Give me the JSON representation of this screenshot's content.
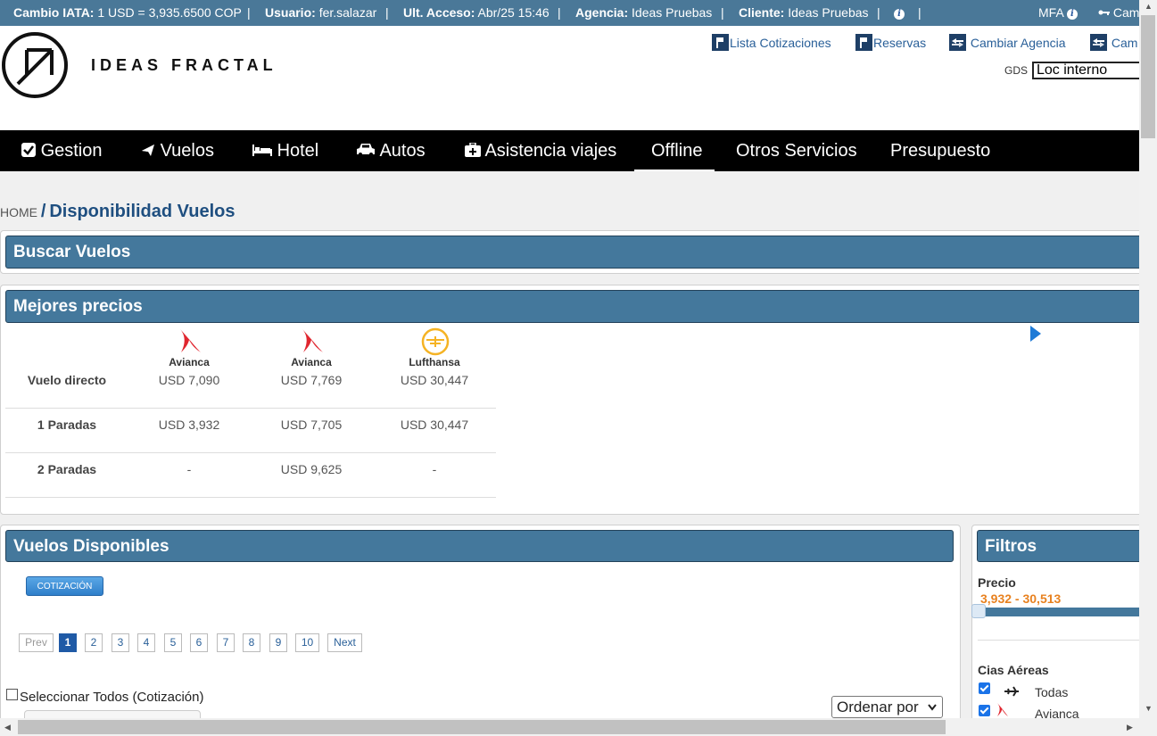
{
  "topbar": {
    "cambio_label": "Cambio IATA:",
    "cambio_value": "1 USD = 3,935.6500 COP",
    "usuario_label": "Usuario:",
    "usuario_value": "fer.salazar",
    "acceso_label": "Ult. Acceso:",
    "acceso_value": "Abr/25 15:46",
    "agencia_label": "Agencia:",
    "agencia_value": "Ideas Pruebas",
    "cliente_label": "Cliente:",
    "cliente_value": "Ideas Pruebas",
    "separator": "|",
    "mfa": "MFA",
    "cambiar_clave": "Cam"
  },
  "header": {
    "logo_text": "IDEAS FRACTAL",
    "links": [
      "Lista Cotizaciones",
      "Reservas",
      "Cambiar Agencia",
      "Cam"
    ],
    "gds_label": "GDS",
    "gds_value": "Loc interno"
  },
  "nav": {
    "items": [
      "Gestion",
      "Vuelos",
      "Hotel",
      "Autos",
      "Asistencia viajes",
      "Offline",
      "Otros Servicios",
      "Presupuesto"
    ],
    "active": "Offline"
  },
  "breadcrumb": {
    "home": "HOME",
    "sep": "/",
    "current": "Disponibilidad Vuelos"
  },
  "buscar": {
    "title": "Buscar Vuelos"
  },
  "mejores": {
    "title": "Mejores precios",
    "airlines": [
      "Avianca",
      "Avianca",
      "Lufthansa"
    ],
    "rows": [
      {
        "label": "Vuelo directo",
        "values": [
          "USD 7,090",
          "USD 7,769",
          "USD 30,447"
        ]
      },
      {
        "label": "1 Paradas",
        "values": [
          "USD 3,932",
          "USD 7,705",
          "USD 30,447"
        ]
      },
      {
        "label": "2 Paradas",
        "values": [
          "-",
          "USD 9,625",
          "-"
        ]
      }
    ]
  },
  "vuelos": {
    "title": "Vuelos Disponibles",
    "cotizacion_btn": "COTIZACIÓN",
    "pagination": [
      "Prev",
      "1",
      "2",
      "3",
      "4",
      "5",
      "6",
      "7",
      "8",
      "9",
      "10",
      "Next"
    ],
    "current_page": "1",
    "select_all": "Seleccionar Todos (Cotización)",
    "ordenar": "Ordenar por"
  },
  "filtros": {
    "title": "Filtros",
    "precio_label": "Precio",
    "precio_range": "3,932 - 30,513",
    "cias_label": "Cias Aéreas",
    "cias": [
      "Todas",
      "Avianca"
    ]
  },
  "colors": {
    "topbar": "#4a7898",
    "panel_header": "#44789c",
    "nav": "#000000",
    "accent": "#1f4f80",
    "price_range": "#e8811f"
  }
}
